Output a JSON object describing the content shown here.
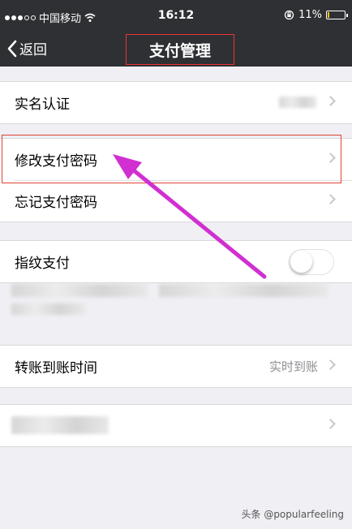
{
  "status_bar": {
    "carrier": "中国移动",
    "time": "16:12",
    "battery_percent": "11%",
    "battery_level": 0.11,
    "icons": [
      "signal-dots",
      "wifi-icon",
      "lock-rotation-icon",
      "battery-icon"
    ]
  },
  "nav": {
    "back_label": "返回",
    "title": "支付管理"
  },
  "groups": {
    "identity": {
      "label": "实名认证"
    },
    "password": {
      "change_label": "修改支付密码",
      "forgot_label": "忘记支付密码"
    },
    "fingerprint": {
      "label": "指纹支付",
      "toggle_on": false
    },
    "transfer": {
      "label": "转账到账时间",
      "value": "实时到账"
    }
  },
  "watermark": "头条 @popularfeeling",
  "colors": {
    "nav_bg": "#2f3033",
    "page_bg": "#efeff4",
    "highlight": "#dd3333",
    "arrow": "#d12fd1"
  }
}
